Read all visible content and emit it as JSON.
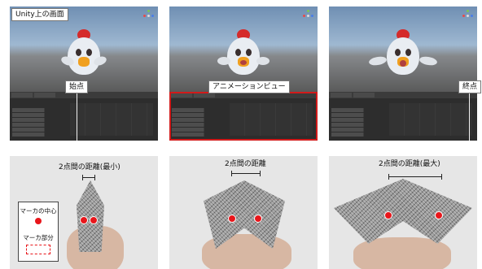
{
  "labels": {
    "unity_screen": "Unity上の画面",
    "start_point": "始点",
    "animation_view": "アニメーションビュー",
    "end_point": "終点",
    "distance_min": "2点間の距離(最小)",
    "distance_mid": "2点間の距離",
    "distance_max": "2点間の距離(最大)"
  },
  "legend": {
    "marker_center": "マーカの中心",
    "marker_part": "マーカ部分"
  },
  "colors": {
    "marker_red": "#e8161b",
    "frame_red": "#d21a1a",
    "unity_bg": "#2b2b2b"
  },
  "icons": [
    "chicken-character-icon",
    "scene-gizmo-icon",
    "marker-center-dot-icon"
  ]
}
